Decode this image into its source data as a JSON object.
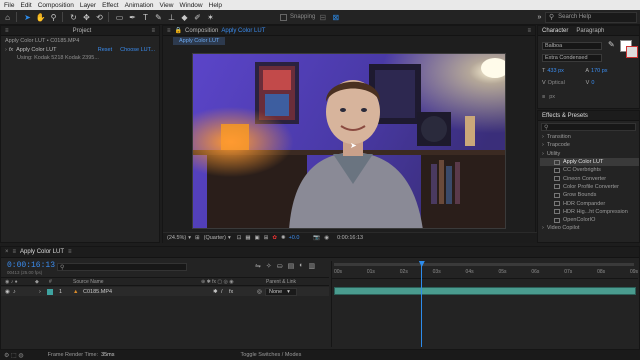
{
  "menu": [
    "File",
    "Edit",
    "Composition",
    "Layer",
    "Effect",
    "Animation",
    "View",
    "Window",
    "Help"
  ],
  "toolbar": {
    "tools": [
      "home-icon",
      "selection-icon",
      "hand-icon",
      "zoom-icon",
      "orbit-icon",
      "move-icon",
      "rotate-icon",
      "rect-icon",
      "pen-icon",
      "text-icon",
      "brush-icon",
      "clone-icon",
      "eraser-icon",
      "roto-icon",
      "pin-icon"
    ],
    "snapping_label": "Snapping",
    "search_placeholder": "Search Help"
  },
  "project_panel": {
    "title": "Project",
    "breadcrumb": "Apply Color LUT • C0185.MP4",
    "effect_name": "Apply Color LUT",
    "reset_label": "Reset",
    "choose_label": "Choose LUT...",
    "using_label": "Using: Kodak 5218 Kodak 2395..."
  },
  "composition_panel": {
    "title_prefix": "Composition",
    "title_name": "Apply Color LUT",
    "tab_label": "Apply Color LUT",
    "zoom": "(24.5%)",
    "resolution": "(Quarter)",
    "exposure": "+0.0",
    "timecode": "0:00:16:13"
  },
  "character_panel": {
    "tab_character": "Character",
    "tab_paragraph": "Paragraph",
    "font": "Balboa",
    "style": "Extra Condensed",
    "size": "433 px",
    "leading": "170 px",
    "kerning": "Optical",
    "tracking": "0",
    "stroke_unit": "px"
  },
  "effects_panel": {
    "title": "Effects & Presets",
    "search_placeholder": "",
    "items": [
      {
        "label": "Transition",
        "type": "folder",
        "selected": false
      },
      {
        "label": "Trapcode",
        "type": "folder",
        "selected": false
      },
      {
        "label": "Utility",
        "type": "folder",
        "selected": false
      },
      {
        "label": "Apply Color LUT",
        "type": "effect",
        "selected": true
      },
      {
        "label": "CC Overbrights",
        "type": "effect",
        "selected": false
      },
      {
        "label": "Cineon Converter",
        "type": "effect",
        "selected": false
      },
      {
        "label": "Color Profile Converter",
        "type": "effect",
        "selected": false
      },
      {
        "label": "Grow Bounds",
        "type": "effect",
        "selected": false
      },
      {
        "label": "HDR Compander",
        "type": "effect",
        "selected": false
      },
      {
        "label": "HDR Hig...ht Compression",
        "type": "effect",
        "selected": false
      },
      {
        "label": "OpenColorIO",
        "type": "effect",
        "selected": false
      },
      {
        "label": "Video Copilot",
        "type": "folder",
        "selected": false
      }
    ]
  },
  "timeline": {
    "tab_label": "Apply Color LUT",
    "timecode": "0:00:16:13",
    "frame_info": "00413 (25.00 fps)",
    "columns": {
      "source": "Source Name",
      "parent": "Parent & Link"
    },
    "layer": {
      "number": "1",
      "name": "C0185.MP4",
      "parent": "None"
    },
    "ruler": [
      "00s",
      "01s",
      "02s",
      "03s",
      "04s",
      "05s",
      "06s",
      "07s",
      "08s",
      "09s"
    ],
    "playhead_fraction": 0.295
  },
  "status_bar": {
    "render_label": "Frame Render Time:",
    "render_value": "35ms",
    "toggle_label": "Toggle Switches / Modes"
  },
  "colors": {
    "accent": "#2d8ceb",
    "layer_bar": "#4a9c8f",
    "label_teal": "#3fa3a0"
  }
}
